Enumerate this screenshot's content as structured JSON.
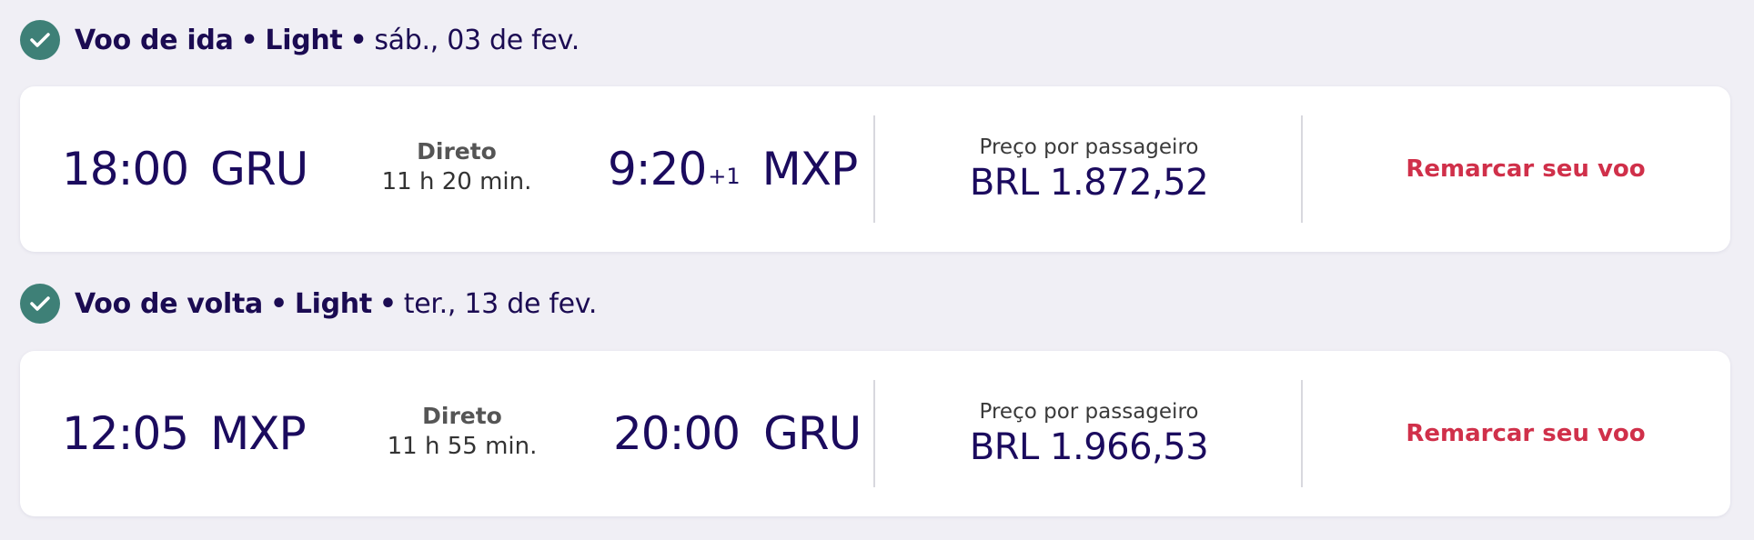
{
  "segments": [
    {
      "header": {
        "title": "Voo de ida",
        "separator": "•",
        "fare": "Light",
        "date": "sáb., 03 de fev."
      },
      "departure_time": "18:00",
      "departure_code": "GRU",
      "stops_label": "Direto",
      "duration": "11 h 20 min.",
      "arrival_time": "9:20",
      "arrival_day_offset": "+1",
      "arrival_code": "MXP",
      "price_label": "Preço por passageiro",
      "price": "BRL 1.872,52",
      "action_label": "Remarcar seu voo"
    },
    {
      "header": {
        "title": "Voo de volta",
        "separator": "•",
        "fare": "Light",
        "date": "ter., 13 de fev."
      },
      "departure_time": "12:05",
      "departure_code": "MXP",
      "stops_label": "Direto",
      "duration": "11 h 55 min.",
      "arrival_time": "20:00",
      "arrival_day_offset": "",
      "arrival_code": "GRU",
      "price_label": "Preço por passageiro",
      "price": "BRL 1.966,53",
      "action_label": "Remarcar seu voo"
    }
  ],
  "icons": {
    "section_status": "check-circle-icon"
  },
  "colors": {
    "background": "#f0eff5",
    "card": "#ffffff",
    "primary_text": "#1b0b5e",
    "check_circle": "#3e8077",
    "action": "#d0304a"
  }
}
